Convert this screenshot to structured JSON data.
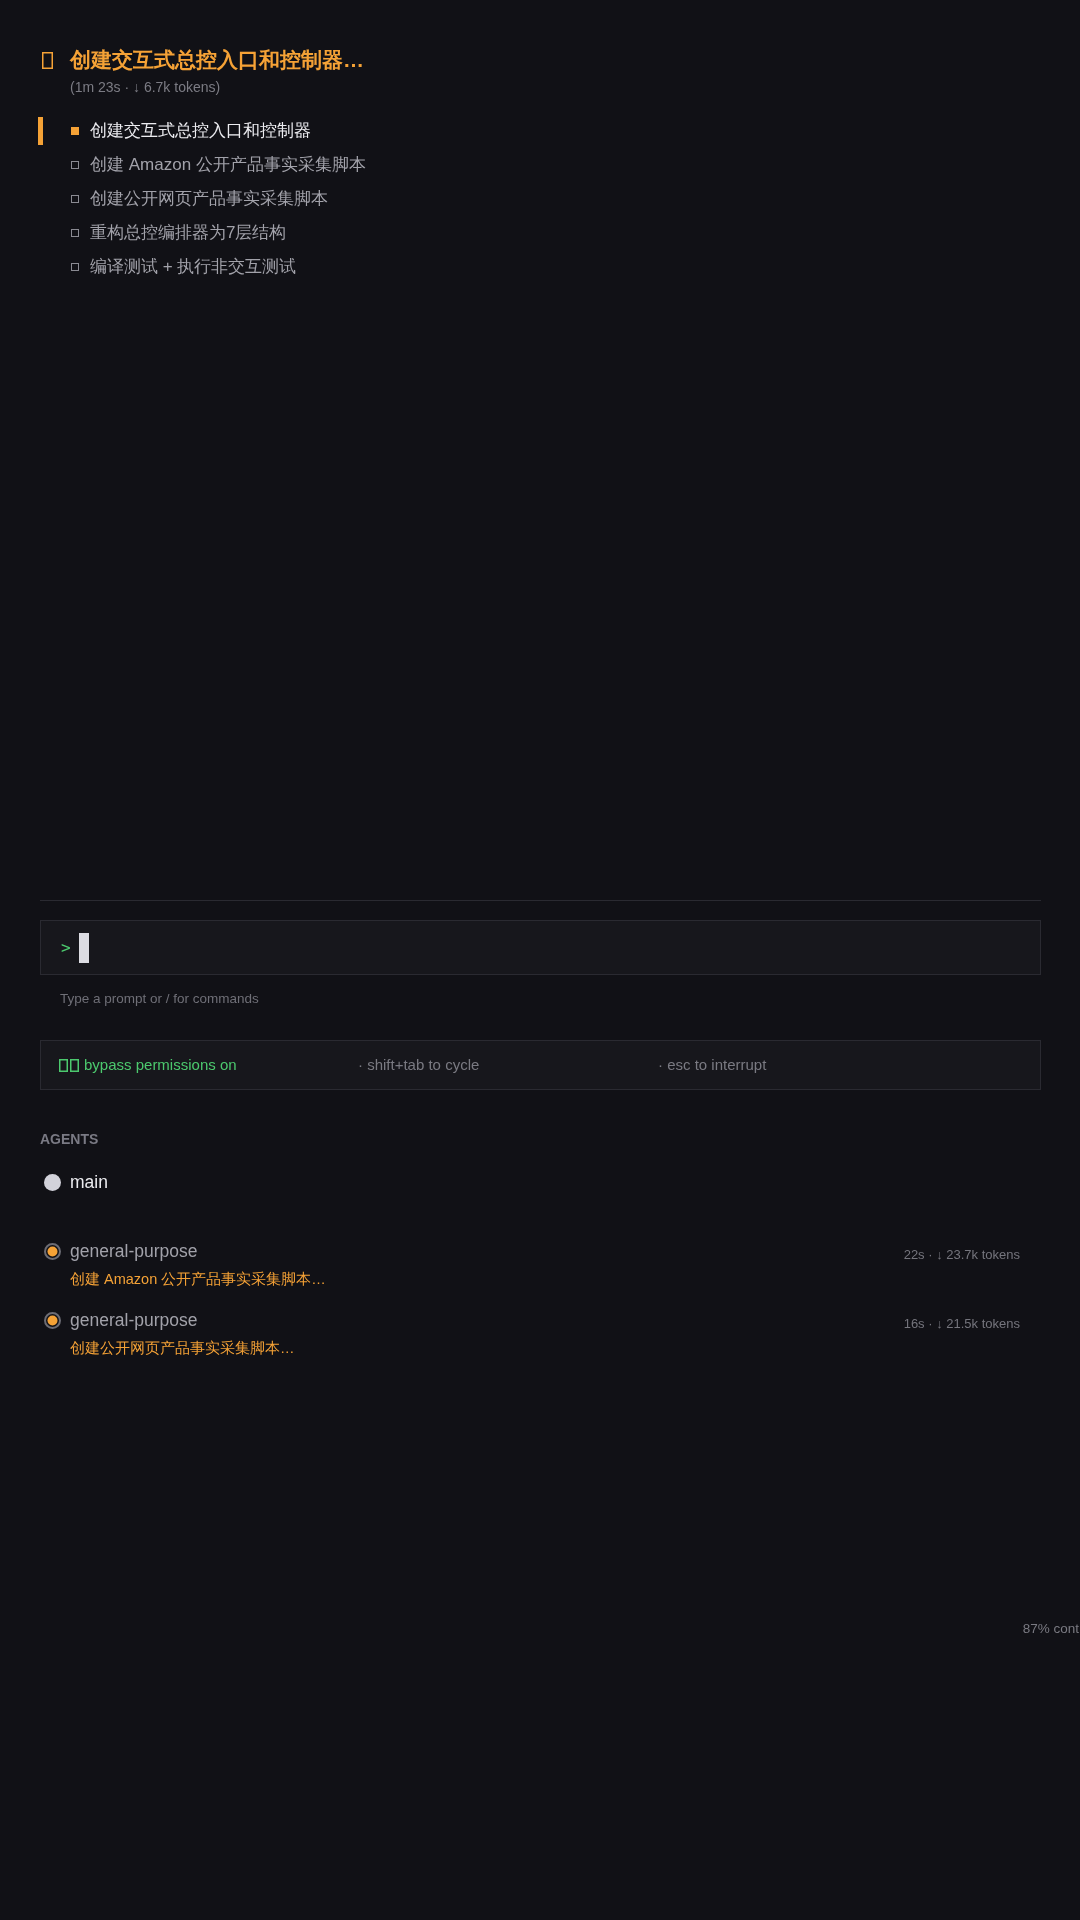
{
  "task": {
    "title": "创建交互式总控入口和控制器…",
    "stats": "(1m 23s · ↓ 6.7k tokens)"
  },
  "todos": [
    {
      "text": "创建交互式总控入口和控制器",
      "in_progress": true
    },
    {
      "text": "创建 Amazon 公开产品事实采集脚本",
      "in_progress": false
    },
    {
      "text": "创建公开网页产品事实采集脚本",
      "in_progress": false
    },
    {
      "text": "重构总控编排器为7层结构",
      "in_progress": false
    },
    {
      "text": "编译测试 + 执行非交互测试",
      "in_progress": false
    }
  ],
  "prompt": {
    "symbol": ">",
    "hint": "Type a prompt or / for commands"
  },
  "mode_bar": {
    "mode": "bypass permissions on",
    "hints": [
      "· shift+tab to cycle",
      "· esc to interrupt"
    ]
  },
  "agents": {
    "heading": "AGENTS",
    "items": [
      {
        "name": "main",
        "color": "#d2d2da",
        "selected": true,
        "running": false
      },
      {
        "name": "general-purpose",
        "color": "#f5a236",
        "selected": false,
        "running": true,
        "task": "创建 Amazon 公开产品事实采集脚本…",
        "stats": "22s · ↓ 23.7k tokens"
      },
      {
        "name": "general-purpose",
        "color": "#f5a236",
        "selected": false,
        "running": true,
        "task": "创建公开网页产品事实采集脚本…",
        "stats": "16s · ↓ 21.5k tokens"
      }
    ]
  },
  "context": "87% cont"
}
